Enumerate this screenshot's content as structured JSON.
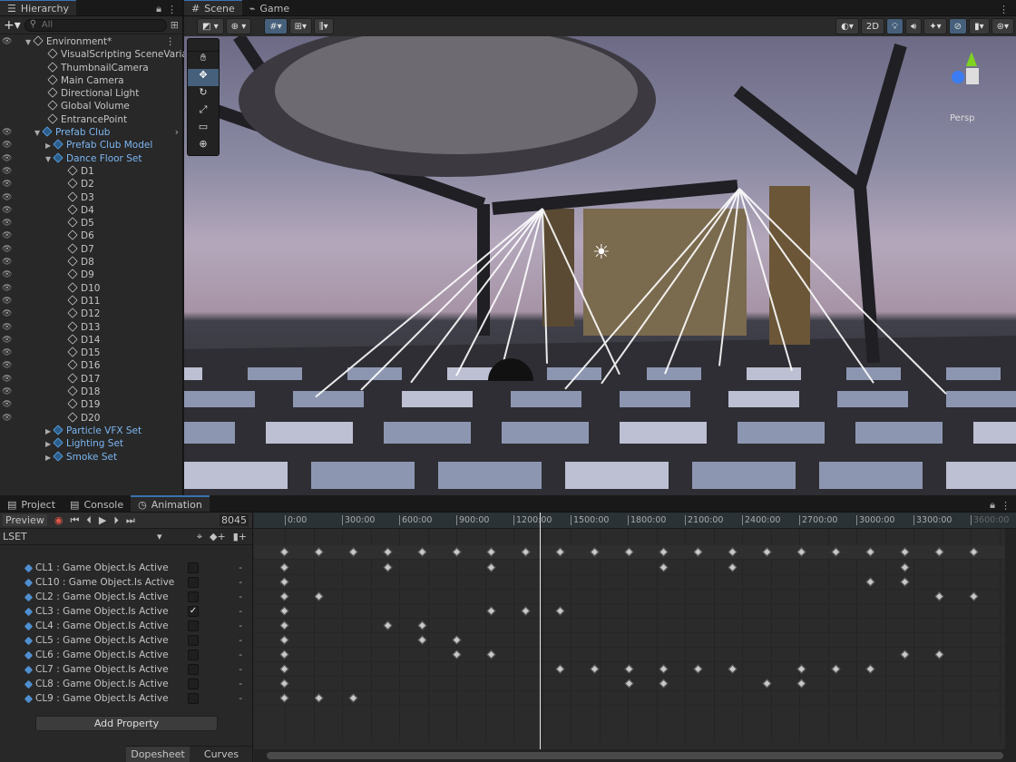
{
  "hierarchy": {
    "tab": "Hierarchy",
    "search_placeholder": "All",
    "root": "Environment*",
    "items": [
      "VisualScripting SceneVaria",
      "ThumbnailCamera",
      "Main Camera",
      "Directional Light",
      "Global Volume",
      "EntrancePoint"
    ],
    "prefab": "Prefab Club",
    "prefab_model": "Prefab Club Model",
    "dance_floor": "Dance Floor Set",
    "floors": [
      "D1",
      "D2",
      "D3",
      "D4",
      "D5",
      "D6",
      "D7",
      "D8",
      "D9",
      "D10",
      "D11",
      "D12",
      "D13",
      "D14",
      "D15",
      "D16",
      "D17",
      "D18",
      "D19",
      "D20"
    ],
    "sets": [
      "Particle VFX Set",
      "Lighting Set",
      "Smoke Set"
    ]
  },
  "scene": {
    "tabs": [
      "Scene",
      "Game"
    ],
    "mode_2d": "2D",
    "persp": "Persp"
  },
  "bottom_tabs": [
    "Project",
    "Console",
    "Animation"
  ],
  "animation": {
    "preview": "Preview",
    "frame": "8045",
    "clip": "LSET",
    "add_property": "Add Property",
    "dopesheet": "Dopesheet",
    "curves": "Curves",
    "ruler": [
      "0:00",
      "300:00",
      "600:00",
      "900:00",
      "1200:00",
      "1500:00",
      "1800:00",
      "2100:00",
      "2400:00",
      "2700:00",
      "3000:00",
      "3300:00",
      "3600:00"
    ],
    "playhead_label": "1200:00",
    "properties": [
      {
        "name": "CL1 : Game Object.Is Active",
        "checked": false,
        "keys": [
          0,
          3,
          6,
          11,
          13,
          18
        ]
      },
      {
        "name": "CL10 : Game Object.Is Active",
        "checked": false,
        "keys": [
          0,
          17,
          18
        ]
      },
      {
        "name": "CL2 : Game Object.Is Active",
        "checked": false,
        "keys": [
          0,
          1,
          19,
          20
        ]
      },
      {
        "name": "CL3 : Game Object.Is Active",
        "checked": true,
        "keys": [
          0,
          6,
          7,
          8
        ]
      },
      {
        "name": "CL4 : Game Object.Is Active",
        "checked": false,
        "keys": [
          0,
          3,
          4
        ]
      },
      {
        "name": "CL5 : Game Object.Is Active",
        "checked": false,
        "keys": [
          0,
          4,
          5
        ]
      },
      {
        "name": "CL6 : Game Object.Is Active",
        "checked": false,
        "keys": [
          0,
          5,
          6,
          18,
          19
        ]
      },
      {
        "name": "CL7 : Game Object.Is Active",
        "checked": false,
        "keys": [
          0,
          8,
          9,
          10,
          11,
          12,
          13,
          15,
          16,
          17
        ]
      },
      {
        "name": "CL8 : Game Object.Is Active",
        "checked": false,
        "keys": [
          0,
          10,
          11,
          14,
          15
        ]
      },
      {
        "name": "CL9 : Game Object.Is Active",
        "checked": false,
        "keys": [
          0,
          1,
          2
        ]
      }
    ],
    "summary_keys": [
      0,
      1,
      2,
      3,
      4,
      5,
      6,
      7,
      8,
      9,
      10,
      11,
      12,
      13,
      14,
      15,
      16,
      17,
      18,
      19,
      20
    ]
  }
}
